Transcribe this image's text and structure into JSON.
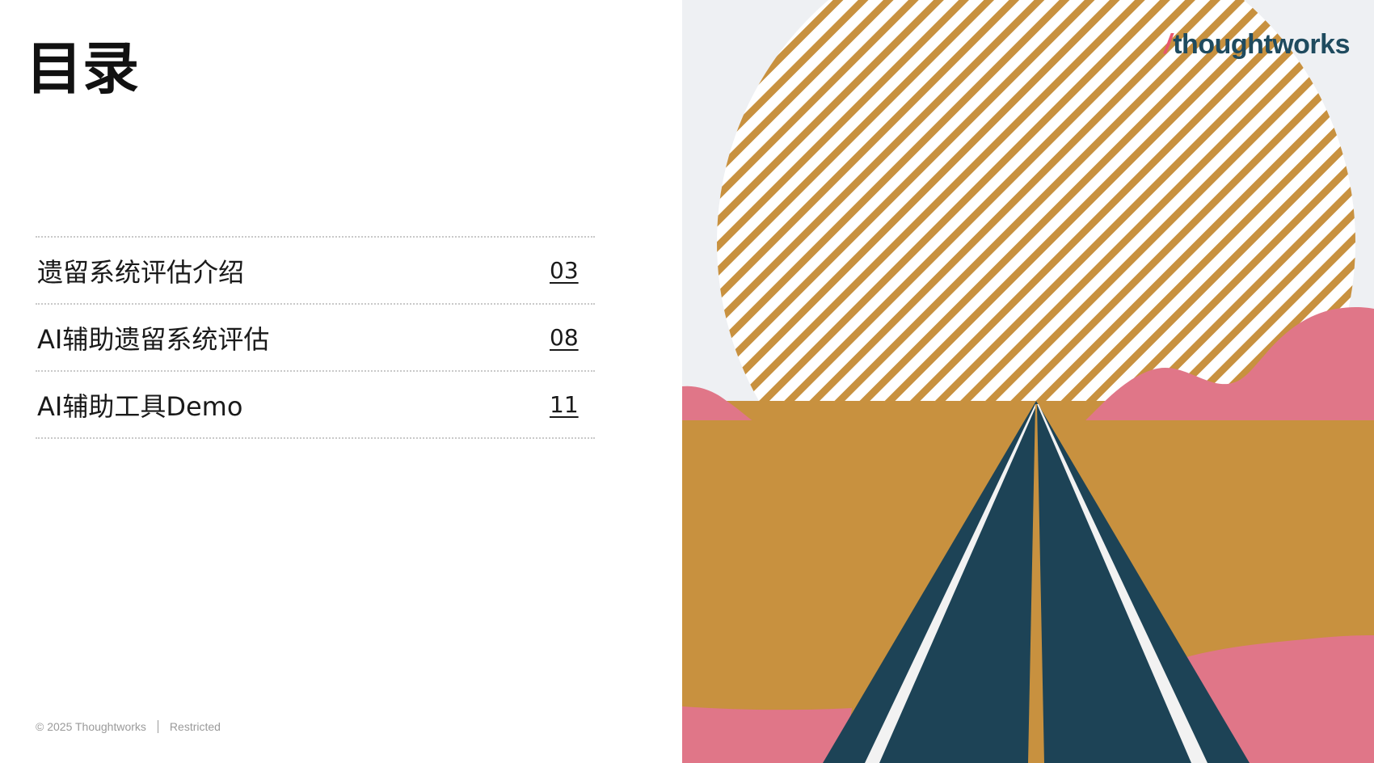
{
  "slide": {
    "title": "目录",
    "toc": [
      {
        "label": "遗留系统评估介绍",
        "page": "03"
      },
      {
        "label": "AI辅助遗留系统评估",
        "page": "08"
      },
      {
        "label": "AI辅助工具Demo",
        "page": "11"
      }
    ],
    "footer": {
      "copyright": "© 2025 Thoughtworks",
      "classification": "Restricted"
    }
  },
  "branding": {
    "logo_text": "thoughtworks",
    "logo_slash": "/"
  },
  "colors": {
    "sky": "#eef0f3",
    "sun_stripe": "#c8913f",
    "desert": "#c8913f",
    "hills": "#e07688",
    "road": "#1d4356",
    "road_line": "#f2f2f2",
    "logo": "#1f4b5f",
    "logo_accent": "#e8566e"
  }
}
